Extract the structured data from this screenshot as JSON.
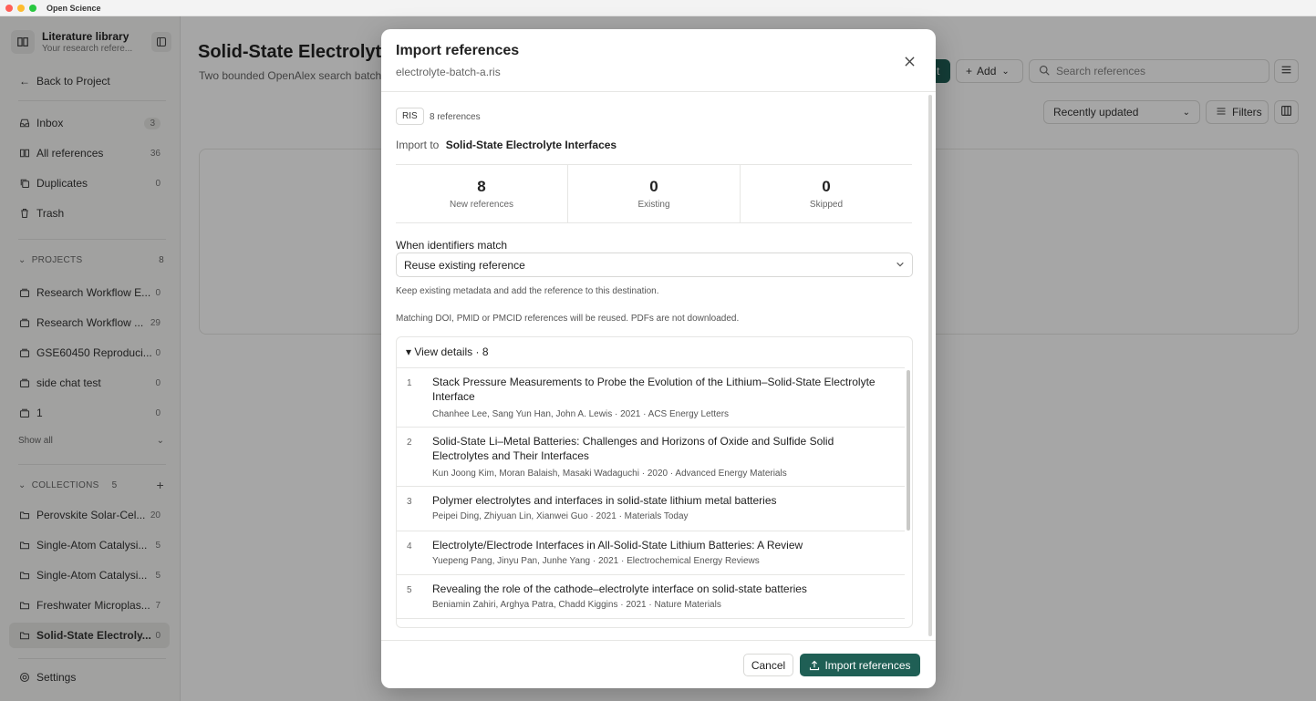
{
  "window": {
    "title": "Open Science",
    "colors": {
      "close": "#ff5f57",
      "minimize": "#febc2e",
      "maximize": "#28c840"
    }
  },
  "sidebar": {
    "library_title": "Literature library",
    "library_subtitle": "Your research refere...",
    "back_label": "Back to Project",
    "nav": [
      {
        "label": "Inbox",
        "count": "3",
        "icon": "inbox-icon"
      },
      {
        "label": "All references",
        "count": "36",
        "icon": "book-icon"
      },
      {
        "label": "Duplicates",
        "count": "0",
        "icon": "copy-icon"
      },
      {
        "label": "Trash",
        "count": "",
        "icon": "trash-icon"
      }
    ],
    "projects_label": "PROJECTS",
    "projects_count": "8",
    "projects": [
      {
        "label": "Research Workflow E...",
        "count": "0"
      },
      {
        "label": "Research Workflow ...",
        "count": "29"
      },
      {
        "label": "GSE60450 Reproduci...",
        "count": "0"
      },
      {
        "label": "side chat test",
        "count": "0"
      },
      {
        "label": "1",
        "count": "0"
      }
    ],
    "show_all": "Show all",
    "collections_label": "COLLECTIONS",
    "collections_count": "5",
    "collections": [
      {
        "label": "Perovskite Solar-Cel...",
        "count": "20"
      },
      {
        "label": "Single-Atom Catalysi...",
        "count": "5"
      },
      {
        "label": "Single-Atom Catalysi...",
        "count": "5"
      },
      {
        "label": "Freshwater Microplas...",
        "count": "7"
      },
      {
        "label": "Solid-State Electroly...",
        "count": "0"
      }
    ],
    "settings_label": "Settings"
  },
  "main": {
    "title": "Solid-State Electrolyte I",
    "subtitle": "Two bounded OpenAlex search batch",
    "primary_partial": "t",
    "add_label": "Add",
    "search_placeholder": "Search references",
    "sort_label": "Recently updated",
    "filters_label": "Filters"
  },
  "modal": {
    "title": "Import references",
    "filename": "electrolyte-batch-a.ris",
    "format": "RIS",
    "format_count": "8 references",
    "import_to_label": "Import to",
    "import_to_value": "Solid-State Electrolyte Interfaces",
    "stats": [
      {
        "value": "8",
        "label": "New references"
      },
      {
        "value": "0",
        "label": "Existing"
      },
      {
        "value": "0",
        "label": "Skipped"
      }
    ],
    "match_label": "When identifiers match",
    "match_value": "Reuse existing reference",
    "hint_metadata": "Keep existing metadata and add the reference to this destination.",
    "hint_matching": "Matching DOI, PMID or PMCID references will be reused. PDFs are not downloaded.",
    "details_summary": "▾ View details · 8",
    "references": [
      {
        "num": "1",
        "title": "Stack Pressure Measurements to Probe the Evolution of the Lithium–Solid-State Electrolyte Interface",
        "meta": "Chanhee Lee, Sang Yun Han, John A. Lewis · 2021 · ACS Energy Letters"
      },
      {
        "num": "2",
        "title": "Solid-State Li–Metal Batteries: Challenges and Horizons of Oxide and Sulfide Solid Electrolytes and Their Interfaces",
        "meta": "Kun Joong Kim, Moran Balaish, Masaki Wadaguchi · 2020 · Advanced Energy Materials"
      },
      {
        "num": "3",
        "title": "Polymer electrolytes and interfaces in solid-state lithium metal batteries",
        "meta": "Peipei Ding, Zhiyuan Lin, Xianwei Guo · 2021 · Materials Today"
      },
      {
        "num": "4",
        "title": "Electrolyte/Electrode Interfaces in All-Solid-State Lithium Batteries: A Review",
        "meta": "Yuepeng Pang, Jinyu Pan, Junhe Yang · 2021 · Electrochemical Energy Reviews"
      },
      {
        "num": "5",
        "title": "Revealing the role of the cathode–electrolyte interface on solid-state batteries",
        "meta": "Beniamin Zahiri, Arghya Patra, Chadd Kiggins · 2021 · Nature Materials"
      }
    ],
    "cancel_label": "Cancel",
    "import_label": "Import references",
    "accent": "#1f5f55"
  }
}
